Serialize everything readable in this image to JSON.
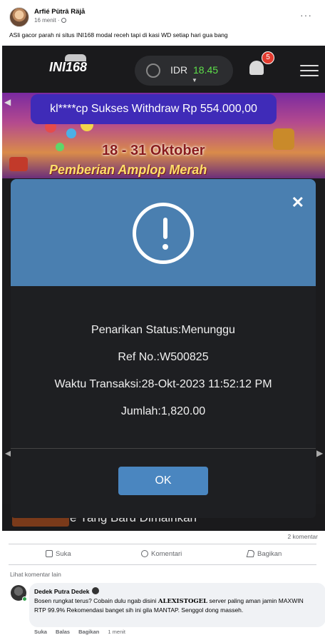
{
  "post": {
    "author": "Arfié Pütrâ Räjå",
    "time": "16 menit ·",
    "more": "···",
    "caption": "ASli gacor parah ni situs INI168 modal receh tapi di kasi WD setiap hari gua bang"
  },
  "site": {
    "logo": "INI168",
    "currency": "IDR",
    "balance": "18.45",
    "notification_count": "5",
    "ticker": "kl****cp Sukses Withdraw Rp 554.000,00",
    "promo_date": "18 - 31 Oktober",
    "promo_title": "Pemberian Amplop Merah",
    "recent_games": "e Yang Baru Dimainkan"
  },
  "modal": {
    "close": "✕",
    "status_line": "Penarikan Status:Menunggu",
    "ref_line": "Ref No.:W500825",
    "time_line": "Waktu Transaksi:28-Okt-2023 11:52:12 PM",
    "amount_line": "Jumlah:1,820.00",
    "ok_label": "OK"
  },
  "engagement": {
    "comment_count": "2 komentar",
    "like_label": "Suka",
    "comment_label": "Komentari",
    "share_label": "Bagikan",
    "more_comments": "Lihat komentar lain"
  },
  "comment": {
    "name": "Dedek Putra Dedek",
    "text_before": "Bosen rungkat terus? Cobain dulu ngab disini ",
    "highlight": "ALEXISTOGEL",
    "text_after": " server paling aman jamin MAXWIN RTP 99.9% Rekomendasi banget sih ini gila MANTAP. Senggol dong masseh.",
    "like": "Suka",
    "reply": "Balas",
    "share": "Bagikan",
    "time": "1 menit"
  },
  "colors": {
    "modal_header": "#4a7fb0",
    "ok_button": "#4a86c0",
    "balance_green": "#5ee04a",
    "badge_red": "#e23b2f",
    "ticker_bg": "#3f2bb8"
  }
}
